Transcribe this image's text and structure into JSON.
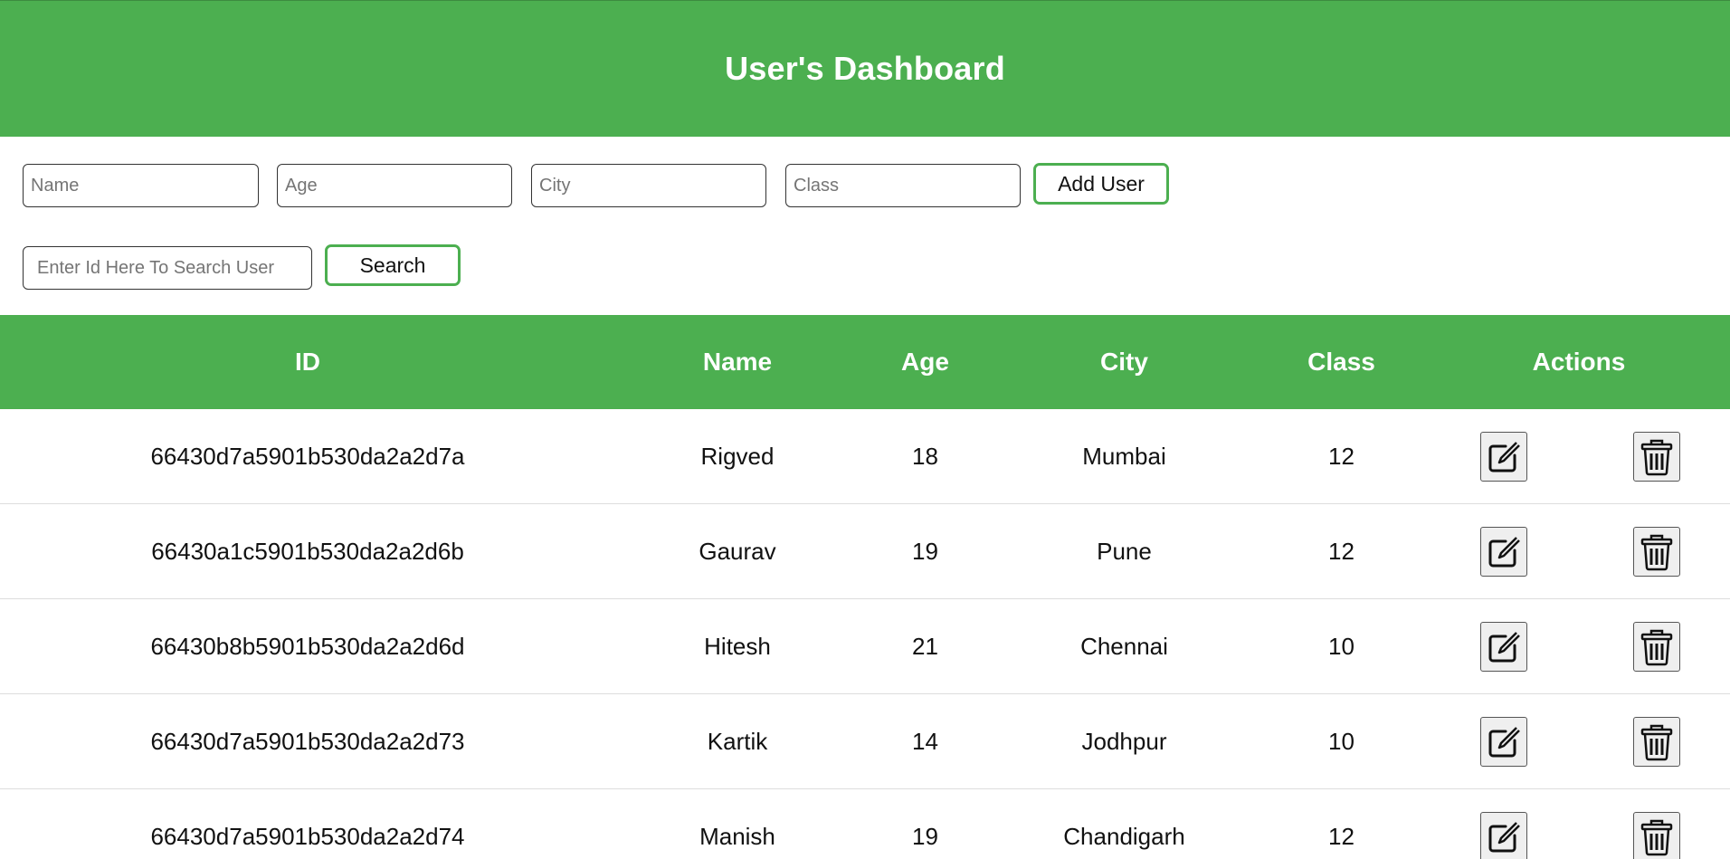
{
  "header": {
    "title": "User's Dashboard"
  },
  "form": {
    "name_placeholder": "Name",
    "age_placeholder": "Age",
    "city_placeholder": "City",
    "class_placeholder": "Class",
    "add_button_label": "Add User"
  },
  "search": {
    "placeholder": "Enter Id Here To Search User",
    "button_label": "Search"
  },
  "table": {
    "columns": {
      "id": "ID",
      "name": "Name",
      "age": "Age",
      "city": "City",
      "class": "Class",
      "actions": "Actions"
    },
    "rows": [
      {
        "id": "66430d7a5901b530da2a2d7a",
        "name": "Rigved",
        "age": "18",
        "city": "Mumbai",
        "class": "12"
      },
      {
        "id": "66430a1c5901b530da2a2d6b",
        "name": "Gaurav",
        "age": "19",
        "city": "Pune",
        "class": "12"
      },
      {
        "id": "66430b8b5901b530da2a2d6d",
        "name": "Hitesh",
        "age": "21",
        "city": "Chennai",
        "class": "10"
      },
      {
        "id": "66430d7a5901b530da2a2d73",
        "name": "Kartik",
        "age": "14",
        "city": "Jodhpur",
        "class": "10"
      },
      {
        "id": "66430d7a5901b530da2a2d74",
        "name": "Manish",
        "age": "19",
        "city": "Chandigarh",
        "class": "12"
      }
    ]
  },
  "icons": {
    "edit": "edit-icon",
    "delete": "trash-icon"
  },
  "colors": {
    "accent": "#4caf50",
    "text": "#111111",
    "row_border": "#dddddd"
  }
}
